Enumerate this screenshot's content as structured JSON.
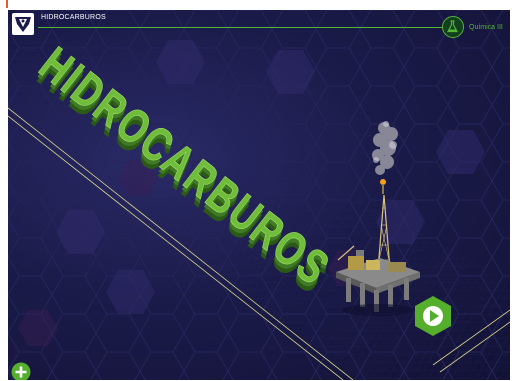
{
  "header": {
    "app_title": "HIDROCARBUROS",
    "subject_label": "Química III",
    "subject_icon": "flask-icon",
    "logo_icon": "university-seal-icon"
  },
  "main": {
    "title_text": "HIDROCARBUROS",
    "illustration": "oil-rig-icon"
  },
  "controls": {
    "play_icon": "play-icon",
    "add_icon": "plus-icon"
  },
  "colors": {
    "accent_green": "#53b637",
    "background_navy": "#1b1b4a",
    "title_green": "#6fbd3a"
  }
}
